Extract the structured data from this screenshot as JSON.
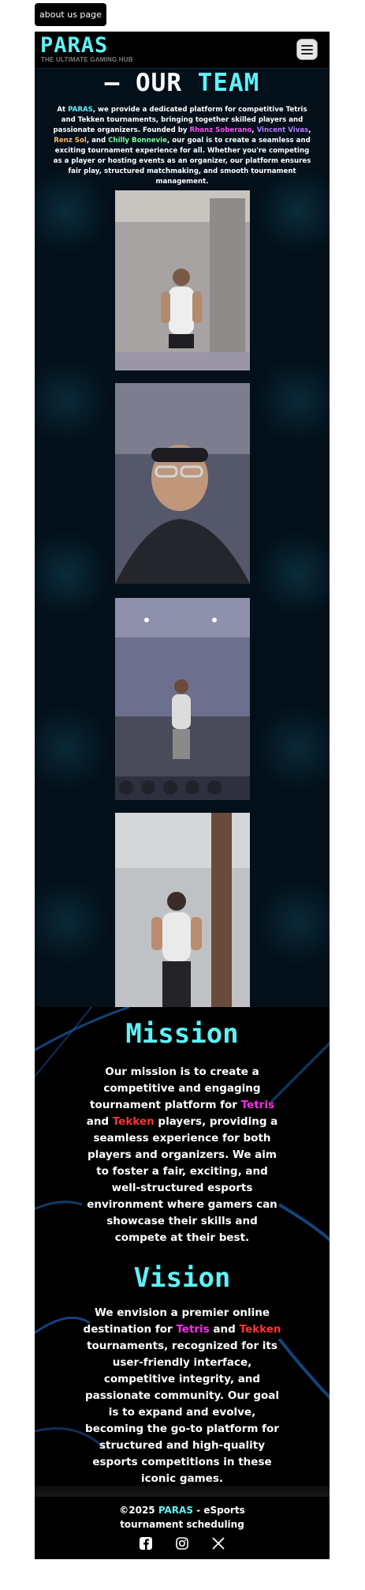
{
  "tab": {
    "label": "about us page"
  },
  "header": {
    "logo": "PARAS",
    "tagline": "THE ULTIMATE GAMING HUB",
    "menu_icon": "hamburger-icon"
  },
  "team": {
    "title_dash": "–",
    "title_main": "OUR",
    "title_accent": "TEAM",
    "desc": {
      "p1": "At ",
      "brand": "PARAS",
      "p2": ", we provide a dedicated platform for competitive Tetris and Tekken tournaments, bringing together skilled players and passionate organizers. Founded by ",
      "name1": "Rhanz Soberano",
      "sep1": ", ",
      "name2": "Vincent Vivas",
      "sep2": ", ",
      "name3": "Renz Sol",
      "sep3": ", and ",
      "name4": "Chilly Bonnevie",
      "p3": ", our goal is to create a seamless and exciting tournament experience for all. Whether you're competing as a player or hosting events as an organizer, our platform ensures fair play, structured matchmaking, and smooth tournament management."
    },
    "colors": {
      "cyan": "#5ff2f7",
      "pink": "#ff4df3",
      "violet": "#b57bff",
      "orange": "#ffb86b",
      "green": "#7cff9c"
    }
  },
  "mission": {
    "title": "Mission",
    "t1": "Our mission is to create a competitive and engaging tournament platform for ",
    "tetris": "Tetris",
    "and": " and ",
    "tekken": "Tekken",
    "t2": " players, providing a seamless experience for both players and organizers. We aim to foster a fair, exciting, and well-structured esports environment where gamers can showcase their skills and compete at their best."
  },
  "vision": {
    "title": "Vision",
    "t1": "We envision a premier online destination for ",
    "tetris": "Tetris",
    "and": " and ",
    "tekken": "Tekken",
    "t2": " tournaments, recognized for its user-friendly interface, competitive integrity, and passionate community. Our goal is to expand and evolve, becoming the go-to platform for structured and high-quality esports competitions in these iconic games."
  },
  "footer": {
    "copy_prefix": "©2025 ",
    "brand": "PARAS",
    "copy_suffix": " - eSports tournament scheduling",
    "icons": [
      "facebook-icon",
      "instagram-icon",
      "x-icon"
    ]
  }
}
